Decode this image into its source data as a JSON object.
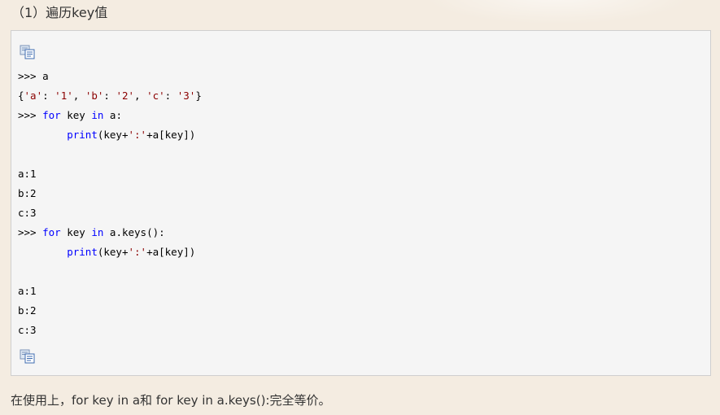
{
  "heading": "（1）遍历key值",
  "code_lines": [
    [
      {
        "t": ">>> a",
        "c": "plain"
      }
    ],
    [
      {
        "t": "{",
        "c": "plain"
      },
      {
        "t": "'a'",
        "c": "str"
      },
      {
        "t": ": ",
        "c": "plain"
      },
      {
        "t": "'1'",
        "c": "str"
      },
      {
        "t": ", ",
        "c": "plain"
      },
      {
        "t": "'b'",
        "c": "str"
      },
      {
        "t": ": ",
        "c": "plain"
      },
      {
        "t": "'2'",
        "c": "str"
      },
      {
        "t": ", ",
        "c": "plain"
      },
      {
        "t": "'c'",
        "c": "str"
      },
      {
        "t": ": ",
        "c": "plain"
      },
      {
        "t": "'3'",
        "c": "str"
      },
      {
        "t": "}",
        "c": "plain"
      }
    ],
    [
      {
        "t": ">>> ",
        "c": "plain"
      },
      {
        "t": "for",
        "c": "kw"
      },
      {
        "t": " key ",
        "c": "plain"
      },
      {
        "t": "in",
        "c": "kw"
      },
      {
        "t": " a:",
        "c": "plain"
      }
    ],
    [
      {
        "t": "        ",
        "c": "plain"
      },
      {
        "t": "print",
        "c": "fn"
      },
      {
        "t": "(key+",
        "c": "plain"
      },
      {
        "t": "':'",
        "c": "str"
      },
      {
        "t": "+a[key])",
        "c": "plain"
      }
    ],
    [],
    [
      {
        "t": "a:1",
        "c": "plain"
      }
    ],
    [
      {
        "t": "b:2",
        "c": "plain"
      }
    ],
    [
      {
        "t": "c:3",
        "c": "plain"
      }
    ],
    [
      {
        "t": ">>> ",
        "c": "plain"
      },
      {
        "t": "for",
        "c": "kw"
      },
      {
        "t": " key ",
        "c": "plain"
      },
      {
        "t": "in",
        "c": "kw"
      },
      {
        "t": " a.keys():",
        "c": "plain"
      }
    ],
    [
      {
        "t": "        ",
        "c": "plain"
      },
      {
        "t": "print",
        "c": "fn"
      },
      {
        "t": "(key+",
        "c": "plain"
      },
      {
        "t": "':'",
        "c": "str"
      },
      {
        "t": "+a[key])",
        "c": "plain"
      }
    ],
    [],
    [
      {
        "t": "a:1",
        "c": "plain"
      }
    ],
    [
      {
        "t": "b:2",
        "c": "plain"
      }
    ],
    [
      {
        "t": "c:3",
        "c": "plain"
      }
    ]
  ],
  "icons": {
    "copy_top": "copy-code-icon",
    "copy_bottom": "copy-code-icon"
  },
  "footer": "在使用上，for key in a和 for key in a.keys():完全等价。",
  "colors": {
    "page_background": "#f4ece1",
    "code_background": "#f5f5f5",
    "code_border": "#cfcfcf",
    "keyword": "#0000ff",
    "string": "#8b0000"
  }
}
